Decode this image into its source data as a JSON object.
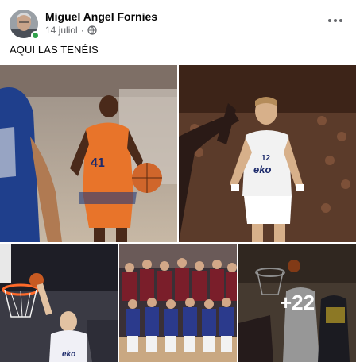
{
  "post": {
    "author_name": "Miguel Angel Fornies",
    "date": "14 juliol",
    "separator": "·",
    "privacy_icon": "globe-icon",
    "more_icon": "more-options-icon",
    "online_status_color": "#31a24c",
    "text": "AQUI LAS TENÉIS"
  },
  "gallery": {
    "remaining_photos_label": "+22",
    "photos": [
      {
        "subject": "player-orange-41",
        "jersey_number": "41"
      },
      {
        "subject": "player-white-12",
        "jersey_number": "12",
        "jersey_text": "eko"
      },
      {
        "subject": "player-dunk",
        "jersey_text": "eko"
      },
      {
        "subject": "team-photo"
      },
      {
        "subject": "game-action"
      }
    ]
  }
}
